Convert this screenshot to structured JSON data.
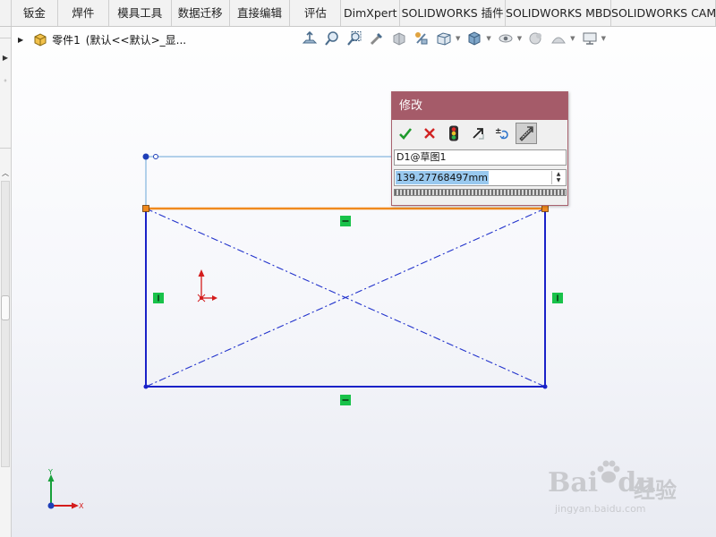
{
  "ribbon": {
    "tabs": [
      {
        "label": "钣金",
        "width": 52
      },
      {
        "label": "焊件",
        "width": 57
      },
      {
        "label": "模具工具",
        "width": 70
      },
      {
        "label": "数据迁移",
        "width": 65
      },
      {
        "label": "直接编辑",
        "width": 68
      },
      {
        "label": "评估",
        "width": 57
      },
      {
        "label": "DimXpert",
        "width": 66
      },
      {
        "label": "SOLIDWORKS 插件",
        "width": 118
      },
      {
        "label": "SOLIDWORKS MBD",
        "width": 118
      },
      {
        "label": "SOLIDWORKS CAM",
        "width": 117
      }
    ]
  },
  "tree": {
    "part_name": "零件1",
    "config": "(默认<<默认>_显..."
  },
  "hud": {
    "icons": [
      "normal-to-icon",
      "zoom-to-fit-icon",
      "zoom-area-icon",
      "previous-view-icon",
      "section-view-icon",
      "dynamic-annotation-icon",
      "view-orientation-icon",
      "display-style-icon",
      "hide-show-icon",
      "edit-appearance-icon",
      "apply-scene-icon",
      "view-settings-icon"
    ]
  },
  "modify": {
    "title": "修改",
    "dimension_name": "D1@草图1",
    "value": "139.27768497mm",
    "buttons": [
      "ok",
      "cancel",
      "rebuild",
      "reverse",
      "mark-for-drawing",
      "magnet"
    ]
  },
  "triad": {
    "x": "X",
    "y": "Y"
  },
  "watermark": {
    "brand": "Bai",
    "brand2": "du",
    "cn": "经验",
    "url": "jingyan.baidu.com"
  },
  "colors": {
    "sketch_line": "#1a22c8",
    "selected_line": "#f08a1e",
    "construction": "#2233cc",
    "relation_badge": "#19c24a",
    "dialog_title": "#a55b69",
    "origin": "#d41c1c"
  }
}
